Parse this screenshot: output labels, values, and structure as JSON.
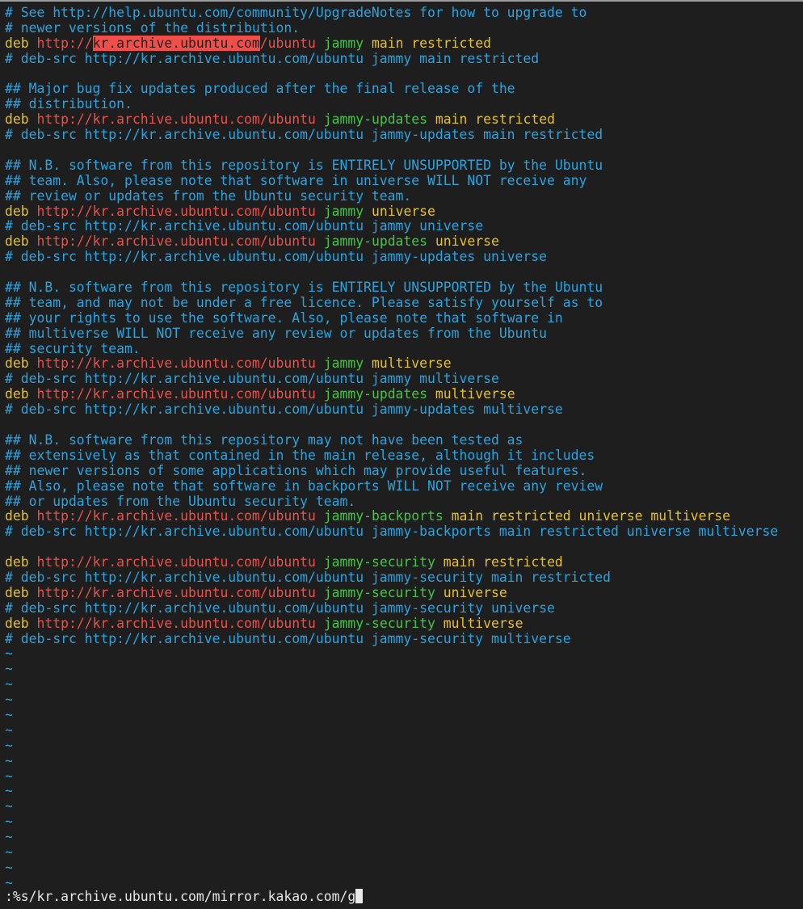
{
  "editor": {
    "lines": [
      {
        "type": "comment",
        "text": "# See http://help.ubuntu.com/community/UpgradeNotes for how to upgrade to"
      },
      {
        "type": "comment",
        "text": "# newer versions of the distribution."
      },
      {
        "type": "deb",
        "kw": "deb",
        "scheme": "http://",
        "host": "kr.archive.ubuntu.com",
        "path": "/ubuntu",
        "suite": "jammy",
        "components": "main restricted",
        "highlight": true
      },
      {
        "type": "comment",
        "text": "# deb-src http://kr.archive.ubuntu.com/ubuntu jammy main restricted"
      },
      {
        "type": "blank",
        "text": ""
      },
      {
        "type": "comment",
        "text": "## Major bug fix updates produced after the final release of the"
      },
      {
        "type": "comment",
        "text": "## distribution."
      },
      {
        "type": "deb",
        "kw": "deb",
        "scheme": "http://",
        "host": "kr.archive.ubuntu.com",
        "path": "/ubuntu",
        "suite": "jammy-updates",
        "components": "main restricted"
      },
      {
        "type": "comment",
        "text": "# deb-src http://kr.archive.ubuntu.com/ubuntu jammy-updates main restricted"
      },
      {
        "type": "blank",
        "text": ""
      },
      {
        "type": "comment",
        "text": "## N.B. software from this repository is ENTIRELY UNSUPPORTED by the Ubuntu"
      },
      {
        "type": "comment",
        "text": "## team. Also, please note that software in universe WILL NOT receive any"
      },
      {
        "type": "comment",
        "text": "## review or updates from the Ubuntu security team."
      },
      {
        "type": "deb",
        "kw": "deb",
        "scheme": "http://",
        "host": "kr.archive.ubuntu.com",
        "path": "/ubuntu",
        "suite": "jammy",
        "components": "universe"
      },
      {
        "type": "comment",
        "text": "# deb-src http://kr.archive.ubuntu.com/ubuntu jammy universe"
      },
      {
        "type": "deb",
        "kw": "deb",
        "scheme": "http://",
        "host": "kr.archive.ubuntu.com",
        "path": "/ubuntu",
        "suite": "jammy-updates",
        "components": "universe"
      },
      {
        "type": "comment",
        "text": "# deb-src http://kr.archive.ubuntu.com/ubuntu jammy-updates universe"
      },
      {
        "type": "blank",
        "text": ""
      },
      {
        "type": "comment",
        "text": "## N.B. software from this repository is ENTIRELY UNSUPPORTED by the Ubuntu"
      },
      {
        "type": "comment",
        "text": "## team, and may not be under a free licence. Please satisfy yourself as to"
      },
      {
        "type": "comment",
        "text": "## your rights to use the software. Also, please note that software in"
      },
      {
        "type": "comment",
        "text": "## multiverse WILL NOT receive any review or updates from the Ubuntu"
      },
      {
        "type": "comment",
        "text": "## security team."
      },
      {
        "type": "deb",
        "kw": "deb",
        "scheme": "http://",
        "host": "kr.archive.ubuntu.com",
        "path": "/ubuntu",
        "suite": "jammy",
        "components": "multiverse"
      },
      {
        "type": "comment",
        "text": "# deb-src http://kr.archive.ubuntu.com/ubuntu jammy multiverse"
      },
      {
        "type": "deb",
        "kw": "deb",
        "scheme": "http://",
        "host": "kr.archive.ubuntu.com",
        "path": "/ubuntu",
        "suite": "jammy-updates",
        "components": "multiverse"
      },
      {
        "type": "comment",
        "text": "# deb-src http://kr.archive.ubuntu.com/ubuntu jammy-updates multiverse"
      },
      {
        "type": "blank",
        "text": ""
      },
      {
        "type": "comment",
        "text": "## N.B. software from this repository may not have been tested as"
      },
      {
        "type": "comment",
        "text": "## extensively as that contained in the main release, although it includes"
      },
      {
        "type": "comment",
        "text": "## newer versions of some applications which may provide useful features."
      },
      {
        "type": "comment",
        "text": "## Also, please note that software in backports WILL NOT receive any review"
      },
      {
        "type": "comment",
        "text": "## or updates from the Ubuntu security team."
      },
      {
        "type": "deb",
        "kw": "deb",
        "scheme": "http://",
        "host": "kr.archive.ubuntu.com",
        "path": "/ubuntu",
        "suite": "jammy-backports",
        "components": "main restricted universe multiverse"
      },
      {
        "type": "comment",
        "text": "# deb-src http://kr.archive.ubuntu.com/ubuntu jammy-backports main restricted universe multiverse"
      },
      {
        "type": "blank",
        "text": ""
      },
      {
        "type": "deb",
        "kw": "deb",
        "scheme": "http://",
        "host": "kr.archive.ubuntu.com",
        "path": "/ubuntu",
        "suite": "jammy-security",
        "components": "main restricted"
      },
      {
        "type": "comment",
        "text": "# deb-src http://kr.archive.ubuntu.com/ubuntu jammy-security main restricted"
      },
      {
        "type": "deb",
        "kw": "deb",
        "scheme": "http://",
        "host": "kr.archive.ubuntu.com",
        "path": "/ubuntu",
        "suite": "jammy-security",
        "components": "universe"
      },
      {
        "type": "comment",
        "text": "# deb-src http://kr.archive.ubuntu.com/ubuntu jammy-security universe"
      },
      {
        "type": "deb",
        "kw": "deb",
        "scheme": "http://",
        "host": "kr.archive.ubuntu.com",
        "path": "/ubuntu",
        "suite": "jammy-security",
        "components": "multiverse"
      },
      {
        "type": "comment",
        "text": "# deb-src http://kr.archive.ubuntu.com/ubuntu jammy-security multiverse"
      },
      {
        "type": "tilde",
        "text": "~"
      },
      {
        "type": "tilde",
        "text": "~"
      },
      {
        "type": "tilde",
        "text": "~"
      },
      {
        "type": "tilde",
        "text": "~"
      },
      {
        "type": "tilde",
        "text": "~"
      },
      {
        "type": "tilde",
        "text": "~"
      },
      {
        "type": "tilde",
        "text": "~"
      },
      {
        "type": "tilde",
        "text": "~"
      },
      {
        "type": "tilde",
        "text": "~"
      },
      {
        "type": "tilde",
        "text": "~"
      },
      {
        "type": "tilde",
        "text": "~"
      },
      {
        "type": "tilde",
        "text": "~"
      },
      {
        "type": "tilde",
        "text": "~"
      },
      {
        "type": "tilde",
        "text": "~"
      },
      {
        "type": "tilde",
        "text": "~"
      },
      {
        "type": "tilde",
        "text": "~"
      }
    ]
  },
  "command_line": {
    "text": ":%s/kr.archive.ubuntu.com/mirror.kakao.com/g"
  },
  "colors": {
    "background": "#1e1e1e",
    "comment": "#2aa4e0",
    "keyword": "#e6c12a",
    "url": "#ef4f48",
    "suite": "#44c544",
    "search_highlight": "#ef4f48"
  }
}
